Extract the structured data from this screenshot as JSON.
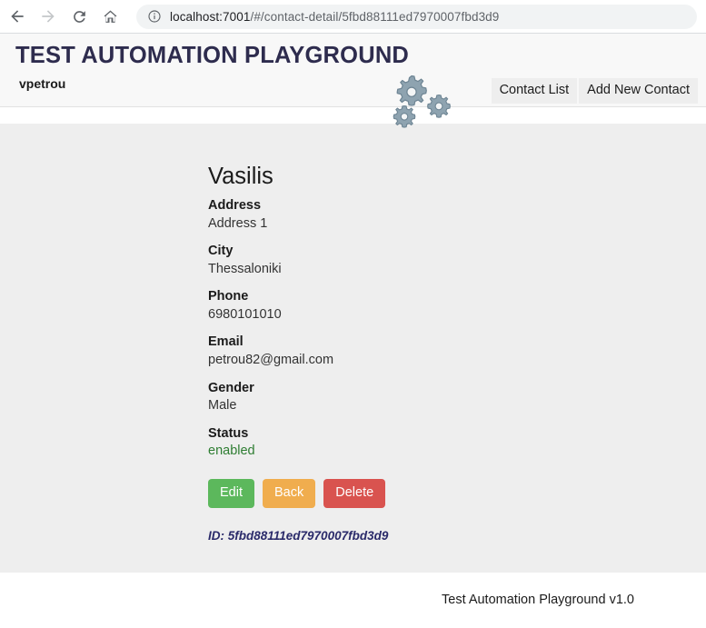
{
  "browser": {
    "back_icon": "arrow-left-icon",
    "forward_icon": "arrow-right-icon",
    "reload_icon": "reload-icon",
    "home_icon": "home-icon",
    "site_info_icon": "info-circle-icon",
    "url_host": "localhost:7001",
    "url_path": "/#/contact-detail/5fbd88111ed7970007fbd3d9",
    "url_full": "localhost:7001/#/contact-detail/5fbd88111ed7970007fbd3d9"
  },
  "header": {
    "title": "TEST AUTOMATION PLAYGROUND",
    "username": "vpetrou",
    "logo_icon": "gears-icon",
    "nav": [
      {
        "label": "Contact List",
        "name": "nav-contact-list"
      },
      {
        "label": "Add New Contact",
        "name": "nav-add-new-contact"
      }
    ]
  },
  "contact": {
    "name": "Vasilis",
    "fields": [
      {
        "label": "Address",
        "value": "Address 1"
      },
      {
        "label": "City",
        "value": "Thessaloniki"
      },
      {
        "label": "Phone",
        "value": "6980101010"
      },
      {
        "label": "Email",
        "value": "petrou82@gmail.com"
      },
      {
        "label": "Gender",
        "value": "Male"
      },
      {
        "label": "Status",
        "value": "enabled"
      }
    ],
    "address_label": "Address",
    "address_value": "Address 1",
    "city_label": "City",
    "city_value": "Thessaloniki",
    "phone_label": "Phone",
    "phone_value": "6980101010",
    "email_label": "Email",
    "email_value": "petrou82@gmail.com",
    "gender_label": "Gender",
    "gender_value": "Male",
    "status_label": "Status",
    "status_value": "enabled",
    "id_text": "ID: 5fbd88111ed7970007fbd3d9"
  },
  "actions": {
    "edit_label": "Edit",
    "back_label": "Back",
    "delete_label": "Delete"
  },
  "footer": {
    "text": "Test Automation Playground v1.0"
  },
  "colors": {
    "brand_title": "#2e2c4e",
    "page_background": "#eeeeee",
    "header_background": "#f8f8f8",
    "status_enabled": "#2e7d32",
    "edit_button": "#5cb85c",
    "back_button": "#f0ad4e",
    "delete_button": "#d9534f",
    "id_text": "#2a2a6a",
    "gear_icon": "#8ea3b0"
  }
}
